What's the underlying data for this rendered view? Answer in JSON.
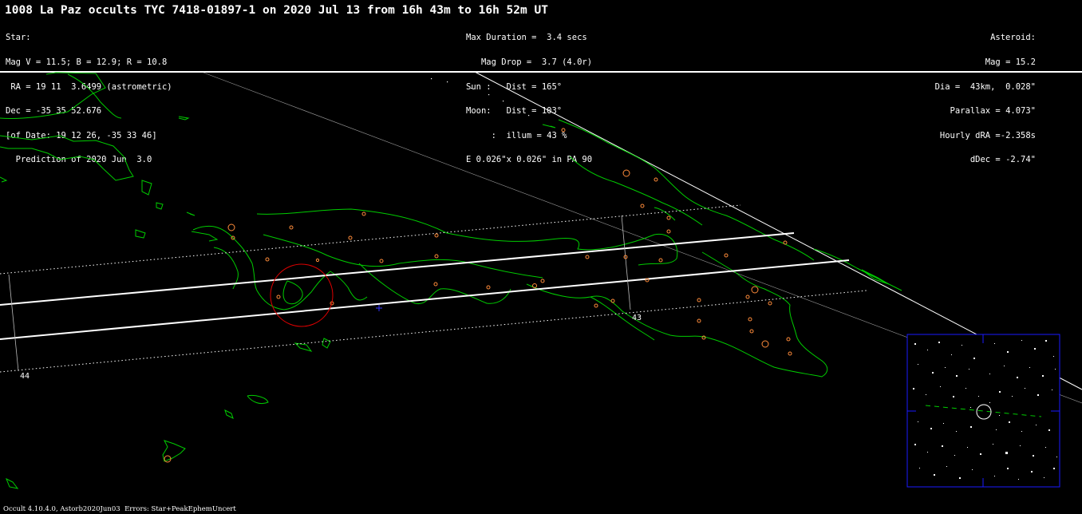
{
  "header": {
    "title": "1008 La Paz occults TYC 7418-01897-1 on 2020 Jul 13 from 16h 43m to 16h 52m UT"
  },
  "star_info": {
    "lines": [
      "Star:",
      "Mag V = 11.5; B = 12.9; R = 10.8",
      " RA = 19 11  3.6499 (astrometric)",
      "Dec = -35 35 52.676",
      "[of Date: 19 12 26, -35 33 46]",
      "  Prediction of 2020 Jun  3.0"
    ]
  },
  "event_info": {
    "lines": [
      "Max Duration =  3.4 secs",
      "   Mag Drop =  3.7 (4.0r)",
      "Sun :   Dist = 165°",
      "Moon:   Dist = 103°",
      "     :  illum = 43 %",
      "E 0.026\"x 0.026\" in PA 90"
    ]
  },
  "asteroid_info": {
    "lines": [
      "Asteroid:",
      "Mag = 15.2",
      "Dia =  43km,  0.028\"",
      "Parallax = 4.073\"",
      "Hourly dRA =-2.358s",
      "dDec = -2.74\""
    ]
  },
  "map": {
    "time_labels": [
      "44",
      "43"
    ],
    "colors": {
      "coastline": "#00cc00",
      "path": "#ffffff",
      "uncertainty": "#ffffff",
      "site": "#ff8c3a",
      "circle": "#dd0000",
      "inset_border": "#1a1aff",
      "marker": "#3333ff"
    }
  },
  "footer": {
    "text": "Occult 4.10.4.0, Astorb2020Jun03  Errors: Star+PeakEphemUncert"
  }
}
